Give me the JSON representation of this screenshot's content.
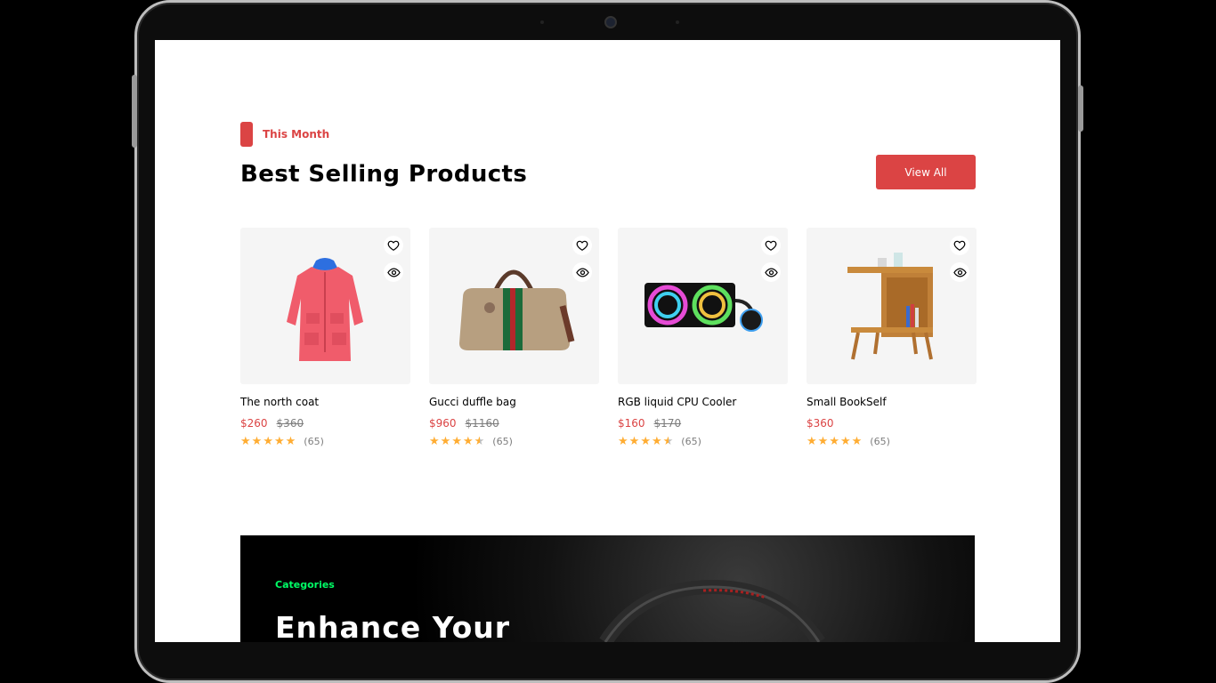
{
  "section": {
    "tag": "This Month",
    "title": "Best Selling Products",
    "view_all": "View All"
  },
  "products": [
    {
      "name": "The north coat",
      "price": "$260",
      "old_price": "$360",
      "rating": 5,
      "reviews": "(65)"
    },
    {
      "name": "Gucci duffle bag",
      "price": "$960",
      "old_price": "$1160",
      "rating": 4.5,
      "reviews": "(65)"
    },
    {
      "name": "RGB liquid CPU Cooler",
      "price": "$160",
      "old_price": "$170",
      "rating": 4.5,
      "reviews": "(65)"
    },
    {
      "name": "Small BookSelf",
      "price": "$360",
      "old_price": "",
      "rating": 5,
      "reviews": "(65)"
    }
  ],
  "banner": {
    "label": "Categories",
    "title": "Enhance Your"
  },
  "colors": {
    "accent": "#db4444",
    "category_green": "#00ff66",
    "star": "#ffad33",
    "card_bg": "#f5f5f5"
  },
  "icons": {
    "favorite": "heart-icon",
    "quick_view": "eye-icon",
    "rating": "star-icon"
  }
}
